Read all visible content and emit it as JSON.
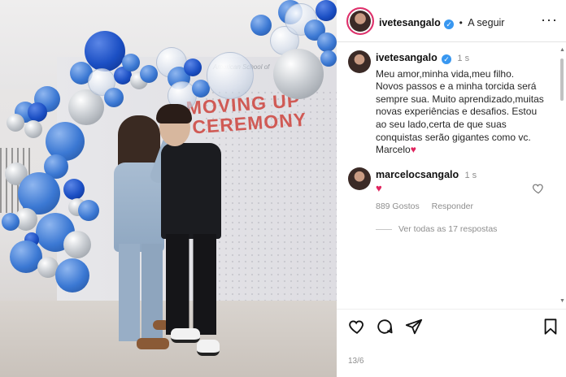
{
  "photo": {
    "sign_school": "American School of",
    "sign_line1": "MOVING UP",
    "sign_line2": "CEREMONY"
  },
  "post": {
    "header": {
      "username": "ivetesangalo",
      "separator": "•",
      "follow_label": "A seguir",
      "more_label": "···"
    },
    "caption": {
      "username": "ivetesangalo",
      "time": "1 s",
      "text": "Meu amor,minha vida,meu filho.\nNovos passos e a minha torcida será sempre sua. Muito aprendizado,muitas novas experiências e desafios. Estou ao seu lado,certa de que suas conquistas serão gigantes como vc. Marcelo",
      "emoji": "♥"
    },
    "comment": {
      "username": "marcelocsangalo",
      "time": "1 s",
      "text": "♥",
      "likes": "889 Gostos",
      "reply_label": "Responder",
      "view_replies": "Ver todas as 17 respostas"
    },
    "date": "13/6"
  },
  "colors": {
    "accent": "#3897f0",
    "heart": "#e0245e",
    "muted": "#8e8e8e"
  },
  "icons": [
    "heart-icon",
    "comment-icon",
    "share-icon",
    "bookmark-icon",
    "verified-icon",
    "more-icon"
  ]
}
